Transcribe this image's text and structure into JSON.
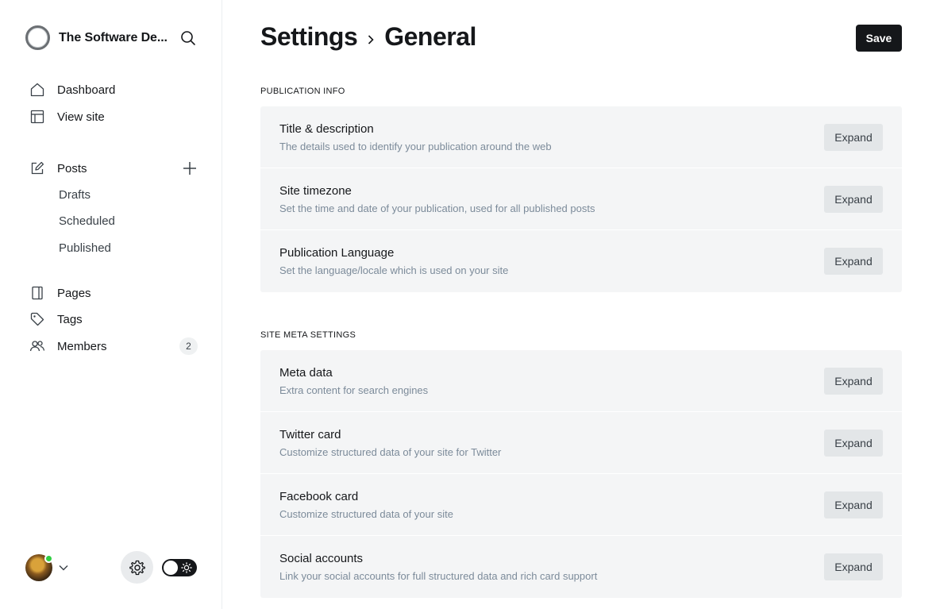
{
  "sidebar": {
    "site_title": "The Software De...",
    "nav": [
      {
        "label": "Dashboard",
        "icon": "home-icon"
      },
      {
        "label": "View site",
        "icon": "layout-icon"
      }
    ],
    "posts": {
      "label": "Posts",
      "icon": "edit-icon",
      "sub": [
        "Drafts",
        "Scheduled",
        "Published"
      ]
    },
    "nav2": [
      {
        "label": "Pages",
        "icon": "page-icon"
      },
      {
        "label": "Tags",
        "icon": "tag-icon"
      },
      {
        "label": "Members",
        "icon": "members-icon",
        "count": "2"
      }
    ]
  },
  "header": {
    "crumb_parent": "Settings",
    "crumb_current": "General",
    "save_label": "Save"
  },
  "sections": [
    {
      "title": "PUBLICATION INFO",
      "rows": [
        {
          "title": "Title & description",
          "desc": "The details used to identify your publication around the web",
          "button": "Expand"
        },
        {
          "title": "Site timezone",
          "desc": "Set the time and date of your publication, used for all published posts",
          "button": "Expand"
        },
        {
          "title": "Publication Language",
          "desc": "Set the language/locale which is used on your site",
          "button": "Expand"
        }
      ]
    },
    {
      "title": "SITE META SETTINGS",
      "rows": [
        {
          "title": "Meta data",
          "desc": "Extra content for search engines",
          "button": "Expand"
        },
        {
          "title": "Twitter card",
          "desc": "Customize structured data of your site for Twitter",
          "button": "Expand"
        },
        {
          "title": "Facebook card",
          "desc": "Customize structured data of your site",
          "button": "Expand"
        },
        {
          "title": "Social accounts",
          "desc": "Link your social accounts for full structured data and rich card support",
          "button": "Expand"
        }
      ]
    }
  ],
  "colors": {
    "accent": "#15171a",
    "online": "#30cf43",
    "panel": "#f4f5f6"
  }
}
